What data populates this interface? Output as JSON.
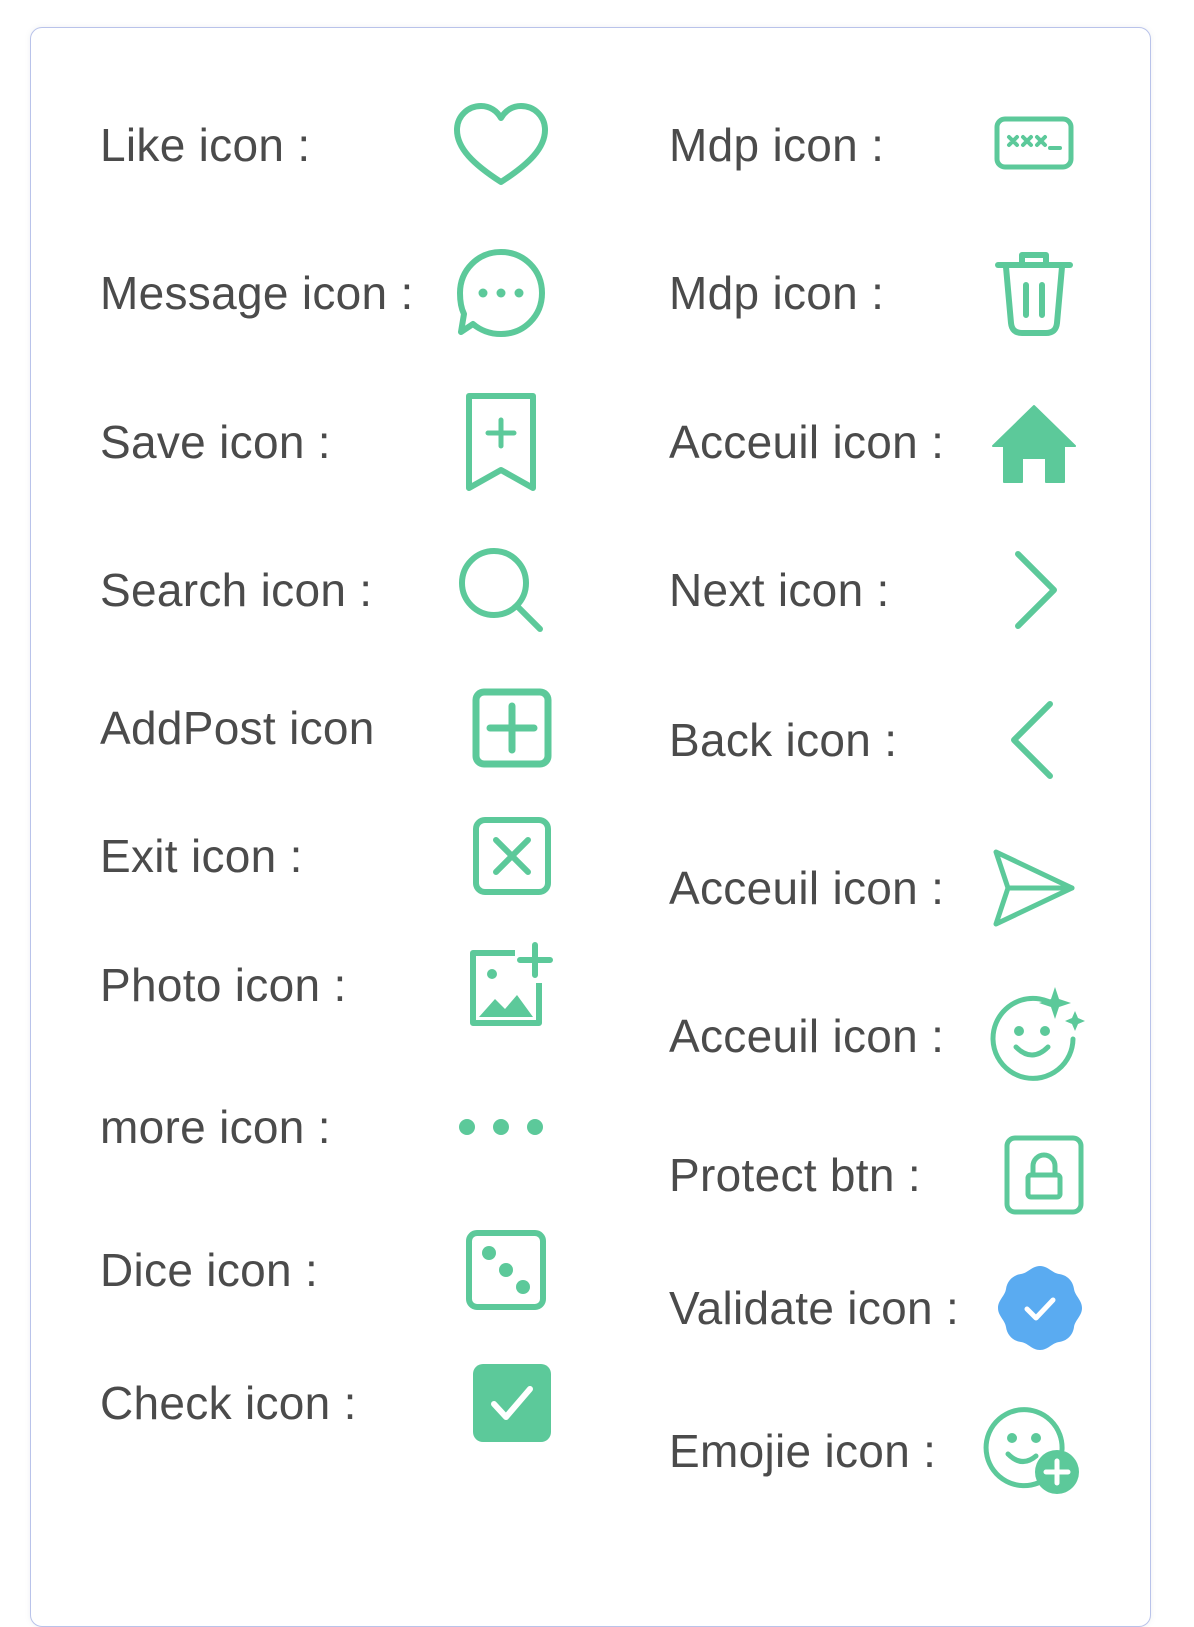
{
  "colors": {
    "accent": "#5cc99a",
    "validate": "#5aabf1",
    "text": "#4b4b4b",
    "card_border": "#b9c3ea"
  },
  "left_items": [
    {
      "label": "Like icon :",
      "icon": "heart-icon"
    },
    {
      "label": "Message icon :",
      "icon": "message-icon"
    },
    {
      "label": "Save icon :",
      "icon": "bookmark-add-icon"
    },
    {
      "label": "Search icon :",
      "icon": "search-icon"
    },
    {
      "label": "AddPost icon",
      "icon": "add-post-icon"
    },
    {
      "label": "Exit icon :",
      "icon": "exit-icon"
    },
    {
      "label": "Photo icon :",
      "icon": "photo-add-icon"
    },
    {
      "label": "more icon :",
      "icon": "more-icon"
    },
    {
      "label": "Dice icon :",
      "icon": "dice-icon"
    },
    {
      "label": "Check icon :",
      "icon": "checkbox-icon"
    }
  ],
  "right_items": [
    {
      "label": "Mdp icon :",
      "icon": "password-icon"
    },
    {
      "label": "Mdp icon :",
      "icon": "trash-icon"
    },
    {
      "label": "Acceuil icon :",
      "icon": "home-icon"
    },
    {
      "label": "Next icon :",
      "icon": "chevron-right-icon"
    },
    {
      "label": "Back icon :",
      "icon": "chevron-left-icon"
    },
    {
      "label": "Acceuil icon :",
      "icon": "send-icon"
    },
    {
      "label": "Acceuil icon :",
      "icon": "smiley-sparkle-icon"
    },
    {
      "label": "Protect btn :",
      "icon": "lock-icon"
    },
    {
      "label": "Validate icon :",
      "icon": "verified-badge-icon"
    },
    {
      "label": "Emojie icon :",
      "icon": "emoji-add-icon"
    }
  ]
}
